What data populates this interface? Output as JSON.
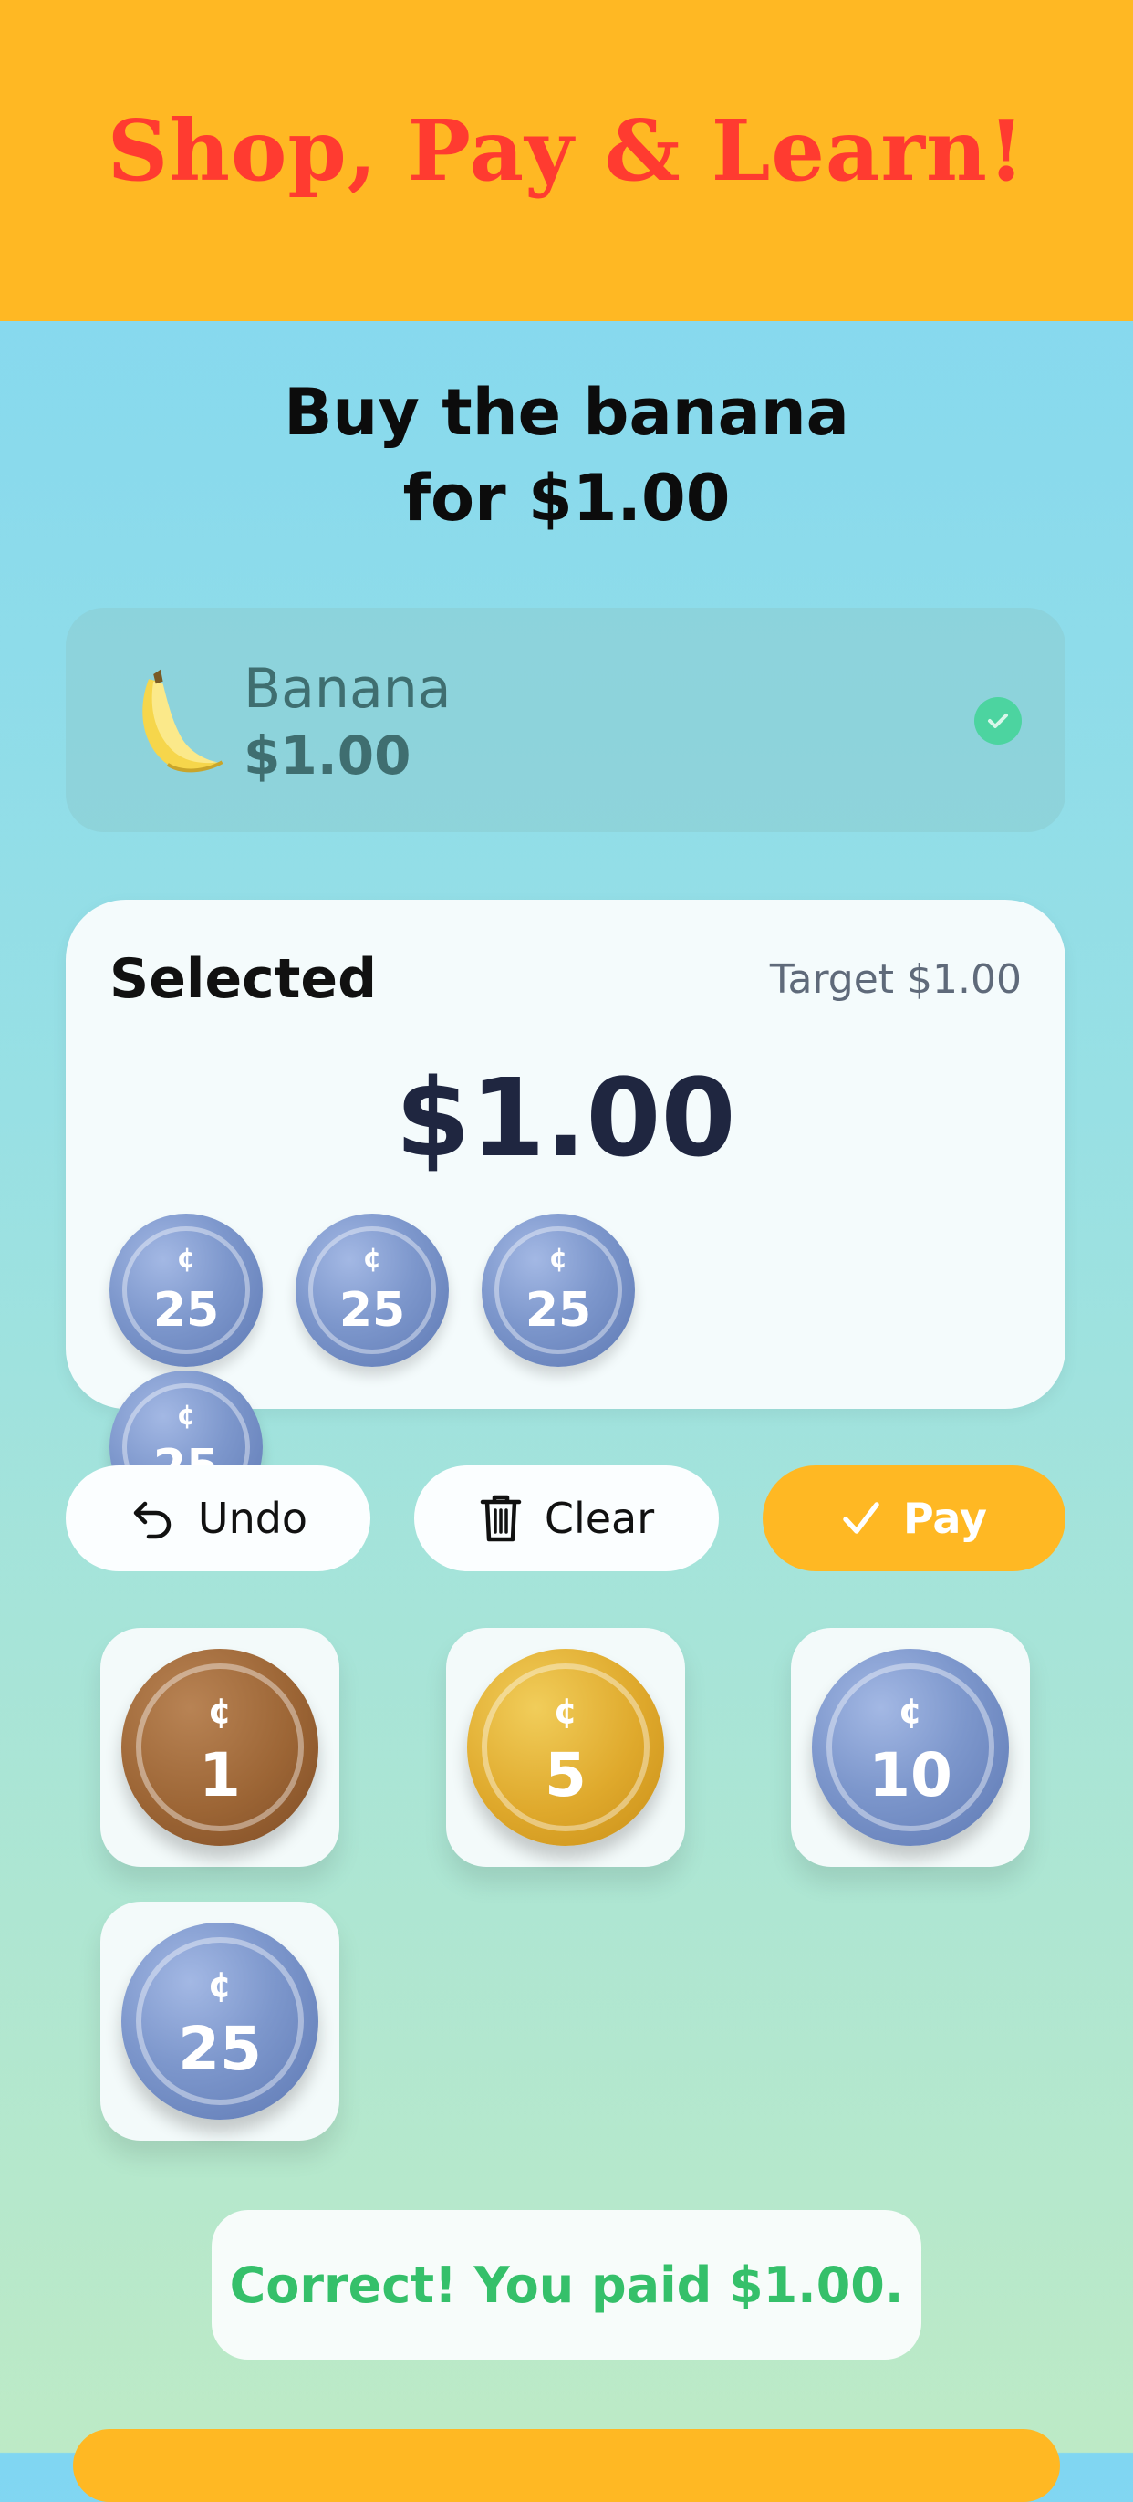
{
  "header": {
    "title": "Shop, Pay & Learn!"
  },
  "prompt": {
    "line1": "Buy the banana",
    "line2": "for $1.00"
  },
  "product": {
    "icon": "banana-icon",
    "name": "Banana",
    "price": "$1.00",
    "selected_check": "check-icon"
  },
  "selection": {
    "label": "Selected",
    "target": "Target $1.00",
    "amount": "$1.00",
    "coins": [
      {
        "symbol": "¢",
        "value": "25"
      },
      {
        "symbol": "¢",
        "value": "25"
      },
      {
        "symbol": "¢",
        "value": "25"
      },
      {
        "symbol": "¢",
        "value": "25"
      }
    ]
  },
  "actions": {
    "undo": "Undo",
    "clear": "Clear",
    "pay": "Pay"
  },
  "coin_palette": [
    {
      "symbol": "¢",
      "value": "1",
      "color": "#9c6535"
    },
    {
      "symbol": "¢",
      "value": "5",
      "color": "#dfa92c"
    },
    {
      "symbol": "¢",
      "value": "10",
      "color": "#7d97cc"
    },
    {
      "symbol": "¢",
      "value": "25",
      "color": "#7d97cc"
    }
  ],
  "feedback": {
    "message": "Correct! You paid $1.00."
  },
  "colors": {
    "accent": "#ffb823",
    "title_red": "#ff3b30",
    "success_green": "#35c06a"
  }
}
